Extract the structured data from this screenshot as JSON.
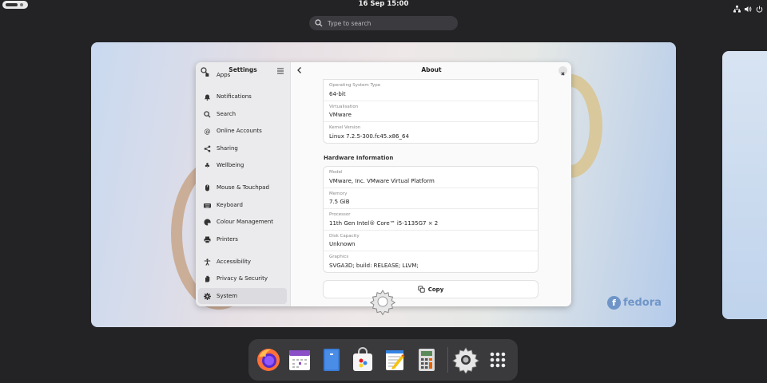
{
  "topbar": {
    "clock": "16 Sep  15:00",
    "tray_icons": [
      "network-icon",
      "volume-icon",
      "power-icon"
    ]
  },
  "search": {
    "placeholder": "Type to search"
  },
  "settings": {
    "sidebar_title": "Settings",
    "items": [
      {
        "label": "Apps",
        "icon": "apps-icon"
      },
      {
        "label": "Notifications",
        "icon": "bell-icon"
      },
      {
        "label": "Search",
        "icon": "search-icon"
      },
      {
        "label": "Online Accounts",
        "icon": "at-icon"
      },
      {
        "label": "Sharing",
        "icon": "share-icon"
      },
      {
        "label": "Wellbeing",
        "icon": "wellbeing-icon"
      },
      {
        "label": "Mouse & Touchpad",
        "icon": "mouse-icon"
      },
      {
        "label": "Keyboard",
        "icon": "keyboard-icon"
      },
      {
        "label": "Colour Management",
        "icon": "palette-icon"
      },
      {
        "label": "Printers",
        "icon": "printer-icon"
      },
      {
        "label": "Accessibility",
        "icon": "accessibility-icon"
      },
      {
        "label": "Privacy & Security",
        "icon": "hand-icon"
      },
      {
        "label": "System",
        "icon": "gear-icon",
        "active": true
      }
    ],
    "page_title": "About",
    "os_rows": [
      {
        "label": "Operating System Type",
        "value": "64-bit"
      },
      {
        "label": "Virtualisation",
        "value": "VMware"
      },
      {
        "label": "Kernel Version",
        "value": "Linux 7.2.5-300.fc45.x86_64"
      }
    ],
    "hardware_title": "Hardware Information",
    "hardware_rows": [
      {
        "label": "Model",
        "value": "VMware, Inc. VMware Virtual Platform"
      },
      {
        "label": "Memory",
        "value": "7.5 GiB"
      },
      {
        "label": "Processor",
        "value": "11th Gen Intel® Core™ i5-1135G7 × 2"
      },
      {
        "label": "Disk Capacity",
        "value": "Unknown"
      },
      {
        "label": "Graphics",
        "value": "SVGA3D; build: RELEASE; LLVM;"
      }
    ],
    "copy_label": "Copy"
  },
  "wallpaper": {
    "brand": "fedora"
  },
  "dock": [
    "firefox-icon",
    "calendar-icon",
    "files-icon",
    "software-icon",
    "text-editor-icon",
    "calculator-icon",
    "settings-icon",
    "app-grid-icon"
  ],
  "colors": {
    "panel": "#232326",
    "dock": "#3a3a3d",
    "accent_fedora": "#6f95c8"
  }
}
